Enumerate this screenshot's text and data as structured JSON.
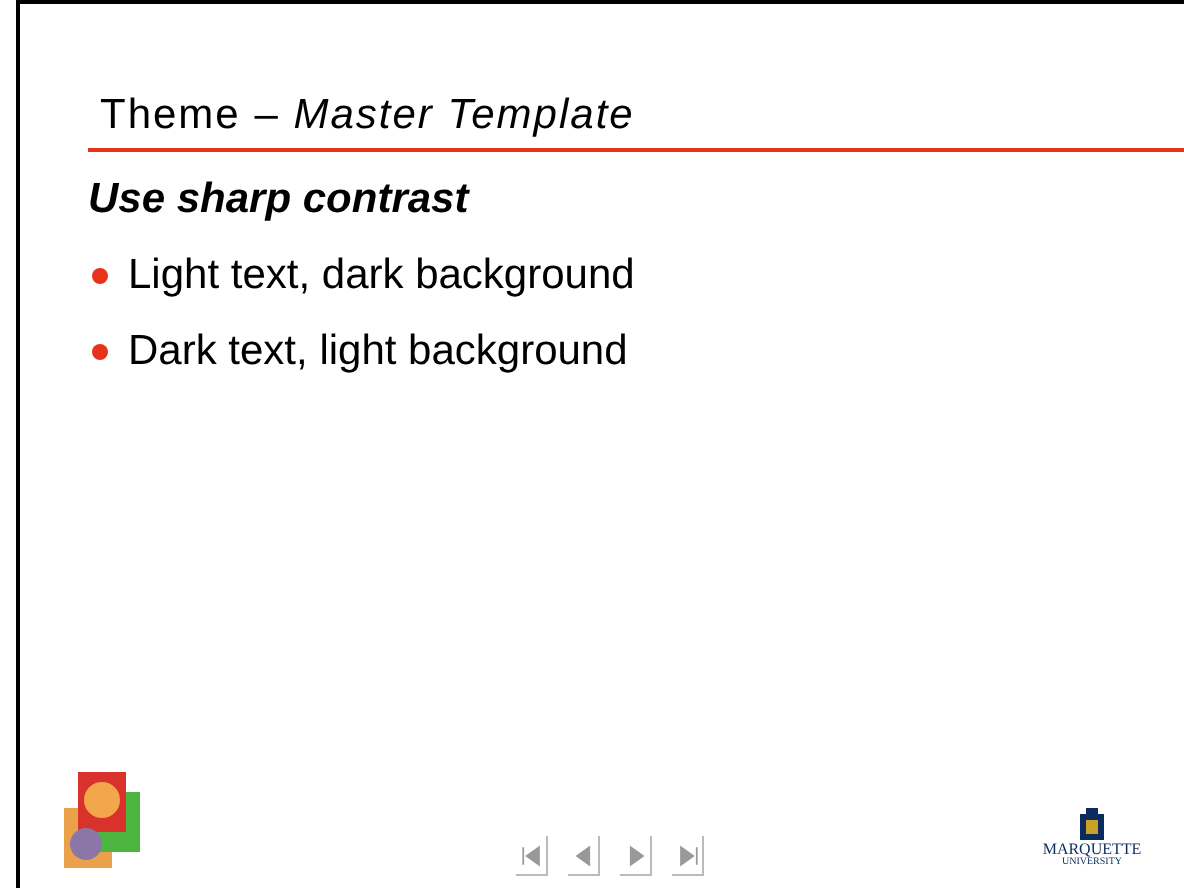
{
  "slide": {
    "title": "Theme –",
    "title_italic": "Master Template",
    "heading": "Use sharp contrast",
    "bullets": [
      "Light text, dark background",
      "Dark text, light background"
    ],
    "logo": {
      "name": "MARQUETTE",
      "subtitle": "UNIVERSITY"
    }
  },
  "navigation": [
    {
      "kind": "first"
    },
    {
      "kind": "prev"
    },
    {
      "kind": "next"
    },
    {
      "kind": "last"
    }
  ]
}
